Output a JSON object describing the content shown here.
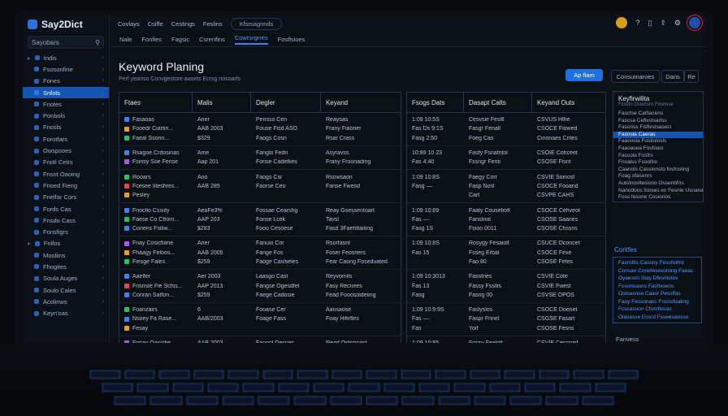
{
  "app": {
    "name": "Say2Dict"
  },
  "sidebar": {
    "search_label": "Sayobars",
    "items": [
      {
        "label": "Indis",
        "group": true
      },
      {
        "label": "Fsosonfine"
      },
      {
        "label": "Fones"
      },
      {
        "label": "Snfols",
        "active": true
      },
      {
        "label": "Fnotes"
      },
      {
        "label": "Ponbols"
      },
      {
        "label": "Fnosts"
      },
      {
        "label": "Forotfars"
      },
      {
        "label": "Owspsoes"
      },
      {
        "label": "Fnotl Cetrs"
      },
      {
        "label": "Fnsnt Oaoing"
      },
      {
        "label": "Fnoed Fieng"
      },
      {
        "label": "Fnelfar Cors"
      },
      {
        "label": "Fords Cas"
      },
      {
        "label": "Fnsdo Cass"
      },
      {
        "label": "Fonsfigrs"
      },
      {
        "label": "Fnifos",
        "group": true
      },
      {
        "label": "Mooliins"
      },
      {
        "label": "Fhogites"
      },
      {
        "label": "Soula Auges"
      },
      {
        "label": "Soulo Cales"
      },
      {
        "label": "Acolinws"
      },
      {
        "label": "Keyn'oas"
      }
    ]
  },
  "topbar": {
    "menus": [
      "Covlays",
      "Csiffe",
      "Cestings",
      "Feslins"
    ],
    "search_placeholder": "Kfsrsagnnds"
  },
  "tabs": [
    {
      "label": "Nale"
    },
    {
      "label": "Fonfies"
    },
    {
      "label": "Fagsic"
    },
    {
      "label": "Csrenfins"
    },
    {
      "label": "Cowrsrgrres",
      "active": true
    },
    {
      "label": "Fosflsioes"
    }
  ],
  "main": {
    "title": "Keyword Planing",
    "subtitle": "Perf yeariso Convgestore aasets Ecrsg roisoarfs",
    "primary_button": "Ap fiam",
    "secondary_button_1": "Consumaroes",
    "secondary_button_2": "Dans",
    "secondary_button_3": "Re"
  },
  "table_left": {
    "headers": [
      "Ftaes",
      "Malis",
      "Degler",
      "Keyand"
    ],
    "groups": [
      [
        {
          "icon": "#3b82f6",
          "c1": "Fasaoas",
          "c2": "Aner",
          "c3": "Pensso Cen",
          "c4": "Reaysas"
        },
        {
          "icon": "#f59e0b",
          "c1": "Fooedr Ciartin...",
          "c2": "AAB 2003",
          "c3": "Fouse Fisd ASO",
          "c4": "Frany Fiaoner"
        },
        {
          "icon": "#22c55e",
          "c1": "Faeal Ssonn...",
          "c2": "$329",
          "c3": "Faogs Cosn",
          "c4": "Rsar Crass"
        }
      ],
      [
        {
          "icon": "#3b82f6",
          "c1": "Rsagoe Crdosinas",
          "c2": "Ame",
          "c3": "Fanglo Fedn",
          "c4": "Asyravss"
        },
        {
          "icon": "#a855f7",
          "c1": "Fsinsy Soe Fense",
          "c2": "Aap 201",
          "c3": "Fonse Cadetkes",
          "c4": "Frany Froonading"
        }
      ],
      [
        {
          "icon": "#22c55e",
          "c1": "Rooars",
          "c2": "Aoo",
          "c3": "Faogs Csr",
          "c4": "Rsowsaon"
        },
        {
          "icon": "#ef4444",
          "c1": "Fcesee Iiteshres...",
          "c2": "AAB 285",
          "c3": "Faorse Ceo",
          "c4": "Fanse Fwesd"
        },
        {
          "icon": "#f59e0b",
          "c1": "Pesley",
          "c2": "",
          "c3": "",
          "c4": ""
        }
      ],
      [
        {
          "icon": "#3b82f6",
          "c1": "Fnocfio Cssiity",
          "c2": "AeaFe3%",
          "c3": "Fossae Cearshg",
          "c4": "Reay Gsessentoart"
        },
        {
          "icon": "#22c55e",
          "c1": "Faese Co Ctforn...",
          "c2": "AAP 203",
          "c3": "Fonse Lcek",
          "c4": "Tavsl"
        },
        {
          "icon": "#3b82f6",
          "c1": "Conens Fsiliw...",
          "c2": "$283",
          "c3": "Fooo Cesoese",
          "c4": "Fasd 3Faehttaiting"
        }
      ],
      [
        {
          "icon": "#a855f7",
          "c1": "Fnay Cosicfiane",
          "c2": "Aner",
          "c3": "Fanuio Cor",
          "c4": "Rsorfasnt"
        },
        {
          "icon": "#f59e0b",
          "c1": "Fhaagy Feloos...",
          "c2": "AAB 2005",
          "c3": "Fange Fos",
          "c4": "Foser Feosriers"
        },
        {
          "icon": "#22c55e",
          "c1": "Fiesge Fales",
          "c2": "$259",
          "c3": "Faoge Caslseles",
          "c4": "Fear Caong Foseduated"
        }
      ],
      [
        {
          "icon": "#3b82f6",
          "c1": "Aaelfer",
          "c2": "Aer 2003",
          "c3": "Laasgo Cast",
          "c4": "Reyvomils"
        },
        {
          "icon": "#ef4444",
          "c1": "Fnsnste Fie Scfss...",
          "c2": "AAP 2013",
          "c3": "Fangse Ogesdfel",
          "c4": "Fasy Recnees"
        },
        {
          "icon": "#3b82f6",
          "c1": "Conran Satfon...",
          "c2": "$259",
          "c3": "Faege Cadosie",
          "c4": "Fead Fooosoideiing"
        }
      ],
      [
        {
          "icon": "#22c55e",
          "c1": "Foanzairs",
          "c2": "6",
          "c3": "Fooase Cer",
          "c4": "Aansaose"
        },
        {
          "icon": "#3b82f6",
          "c1": "Nsoey Fa Rase...",
          "c2": "AAB/2003",
          "c3": "Foage Fass",
          "c4": "Foay Hifirfles"
        },
        {
          "icon": "#f59e0b",
          "c1": "Fesay",
          "c2": "",
          "c3": "",
          "c4": ""
        }
      ],
      [
        {
          "icon": "#a855f7",
          "c1": "Fonay Oasiofie...",
          "c2": "AAB 2003",
          "c3": "Fangol Desnes",
          "c4": "Read Osfonoast"
        },
        {
          "icon": "#3b82f6",
          "c1": "Mosing De Eortes",
          "c2": "$353",
          "c3": "Fange Cosietle",
          "c4": "Pastsaas"
        }
      ],
      [
        {
          "icon": "#22c55e",
          "c1": "Fasfes",
          "c2": "Aer207",
          "c3": "Faose Fesss",
          "c4": "Fesasaofon"
        }
      ]
    ]
  },
  "table_right": {
    "headers": [
      "Fsogs Dats",
      "Dasapt Calts",
      "Keyand Outs"
    ],
    "groups": [
      [
        {
          "c1": "1:09   10:5S",
          "c2": "Cesvsie Fesltl",
          "c3": "CSVUS   Hlhe"
        },
        {
          "c1": "Fas    Ds 9:1S",
          "c2": "Fasgr Fenall",
          "c3": "CSOCE   Fiowed"
        },
        {
          "c1": "Fasg   2:50",
          "c2": "Foeg Cas",
          "c3": "Cinonaes Cntes"
        }
      ],
      [
        {
          "c1": "10:89   10 23",
          "c2": "Fasfy Fsnafntol",
          "c3": "CSOIE   Cohceet"
        },
        {
          "c1": "Fas   4:40",
          "c2": "Fssngr Fenti",
          "c3": "CSOSE   Fisnt"
        }
      ],
      [
        {
          "c1": "1:09   10:8S",
          "c2": "Faegy Corr",
          "c3": "CSVIE   Soiriost"
        },
        {
          "c1": "Fasg   ––",
          "c2": "Fasp Nosl",
          "c3": "CSOCE   Fooand"
        },
        {
          "c1": "",
          "c2": "Cart",
          "c3": "CSVPE   CAHS"
        }
      ],
      [
        {
          "c1": "1:09   10:89",
          "c2": "Faaty Cousefiott",
          "c3": "CSOCE   Cehveot"
        },
        {
          "c1": "Fas    ––",
          "c2": "Fanstnol",
          "c3": "CSOSE   Saanes"
        },
        {
          "c1": "Fasg   1S",
          "c2": "Fsioo 0011",
          "c3": "CSOSE   Chssns"
        }
      ],
      [
        {
          "c1": "1:09   10:8S",
          "c2": "Rosygy Fesaiolt",
          "c3": "CSUCE   Oconcet"
        },
        {
          "c1": "Fas    15",
          "c2": "Fsseg Erbal",
          "c3": "CSOCE   Fexe"
        },
        {
          "c1": "",
          "c2": "Fao 80",
          "c3": "CSOSE   Fetes"
        }
      ],
      [
        {
          "c1": "1:09   10:3013",
          "c2": "Fasstnes",
          "c3": "CSVIE   Cote"
        },
        {
          "c1": "Fas    13",
          "c2": "Fassy Fssllis",
          "c3": "CSVIE   Fwest"
        },
        {
          "c1": "Fasg",
          "c2": "Fasng 00",
          "c3": "CSVSE   OPOS"
        }
      ],
      [
        {
          "c1": "1:09   10:9:9S",
          "c2": "Faslyslos",
          "c3": "CSOCE   Doenet"
        },
        {
          "c1": "Fas    ––",
          "c2": "Faspr Fnnel",
          "c3": "CSGSE   Fasart"
        },
        {
          "c1": "Fas",
          "c2": "Yoif",
          "c3": "CSOSE   Fesns"
        }
      ],
      [
        {
          "c1": "1:09   10:85",
          "c2": "Fossy Fealolt",
          "c3": "CSVIE   Ceccrosf"
        },
        {
          "c1": "Fas    2:1",
          "c2": "Fasay Fiscnes",
          "c3": "CSOIE   Fesad"
        }
      ],
      [
        {
          "c1": "1:09   ––",
          "c2": "Fasgn Feascest",
          "c3": "CSVCE   TFS Aoel"
        }
      ]
    ]
  },
  "panel": {
    "title": "Keyfirwilita",
    "subtitle": "Fcsstn Ostecsro Fnsnsse",
    "items": [
      {
        "label": "Fasctse Catfiacens"
      },
      {
        "label": "Fascsa Cefivstsarlss"
      },
      {
        "label": "Fasonss Fisfivstsaseci"
      },
      {
        "label": "Fasnsla Caeras",
        "active": true
      },
      {
        "label": "Faaoosla Fostiolosls"
      },
      {
        "label": "Faaoasea Fosfoasi"
      },
      {
        "label": "Faccola Fosfrs"
      },
      {
        "label": "Fnoalss Fsoolfre"
      },
      {
        "label": "Caanols Cassionsto fosfosling"
      },
      {
        "label": "Foag ofasenrs"
      },
      {
        "label": "Autolnosltesiono Ossenbfns"
      },
      {
        "label": "Nanodoos fooses ex Fesnle Usnanas"
      },
      {
        "label": "Foss fesone Cosionos"
      }
    ]
  },
  "panel2": {
    "title": "Coritfes",
    "items": [
      "Fasrofits Casony Fesofoiltre",
      "Consan Conefesesolsing Faeas",
      "Oyaeson Stay Dfesrliotes",
      "Fosonsasns Fasfivoens",
      "Ostoasnse Caasr Pesslfas",
      "Faoy Fessonasc Fosnsfoating",
      "Fcscasoon Cfosrfesias",
      "Oiasasse Eosrd Fsseeuaosso"
    ]
  },
  "panel3": {
    "label": "Fanvess"
  }
}
